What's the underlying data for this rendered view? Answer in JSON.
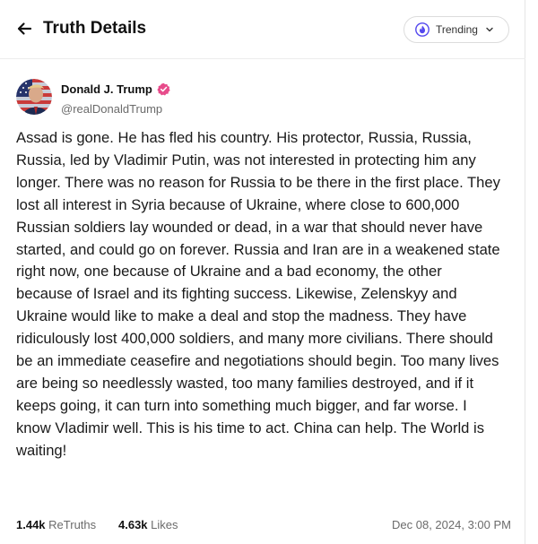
{
  "header": {
    "title": "Truth Details",
    "feed_selector": {
      "label": "Trending",
      "icon": "flame-icon"
    }
  },
  "post": {
    "author": {
      "display_name": "Donald J. Trump",
      "handle": "@realDonaldTrump",
      "verified": true,
      "verified_color": "#e74c8b"
    },
    "text": "Assad is gone. He has fled his country. His protector, Russia, Russia, Russia, led by Vladimir Putin, was not interested in protecting him any longer. There was no reason for Russia to be there in the first place. They lost all interest in Syria because of Ukraine, where close to 600,000 Russian soldiers lay wounded or dead, in a war that should never have started, and could go on forever. Russia and Iran are in a weakened state right now, one because of Ukraine and a bad economy, the other because of Israel and its fighting success. Likewise, Zelenskyy and Ukraine would like to make a deal and stop the madness. They have ridiculously lost 400,000 soldiers, and many more civilians. There should be an immediate ceasefire and negotiations should begin. Too many lives are being so needlessly wasted, too many families destroyed, and if it keeps going, it can turn into something much bigger, and far worse. I know Vladimir well. This is his time to act. China can help. The World is waiting!",
    "stats": {
      "retruths_count": "1.44k",
      "retruths_label": "ReTruths",
      "likes_count": "4.63k",
      "likes_label": "Likes"
    },
    "timestamp": "Dec 08, 2024, 3:00 PM"
  },
  "colors": {
    "accent": "#5448ee",
    "text": "#1a1a1a",
    "muted": "#6b6b6b"
  }
}
